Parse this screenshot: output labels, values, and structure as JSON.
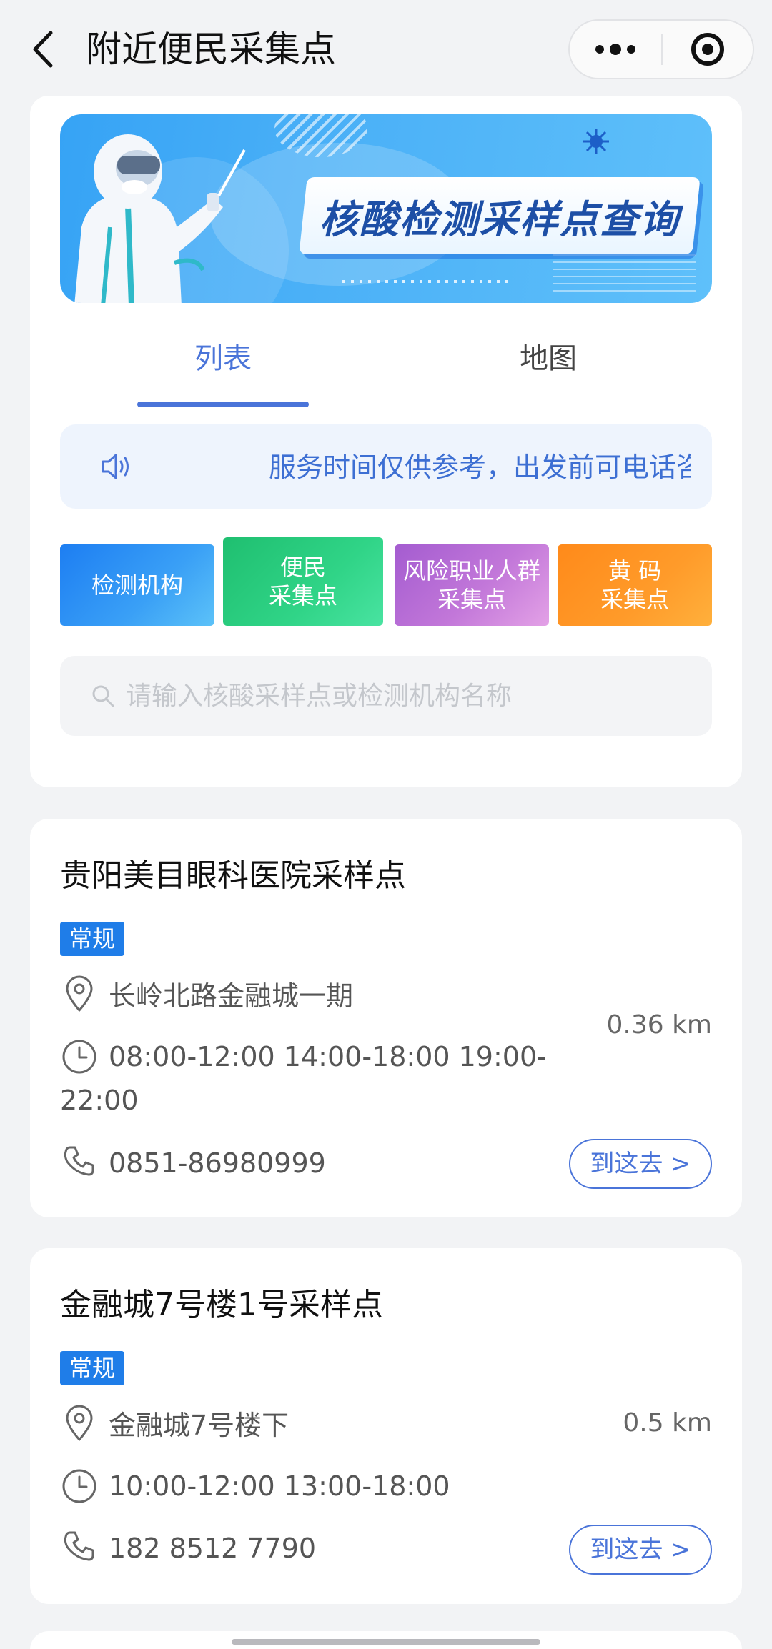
{
  "navbar": {
    "title": "附近便民采集点"
  },
  "banner": {
    "title": "核酸检测采样点查询"
  },
  "tabs": [
    {
      "label": "列表",
      "active": true
    },
    {
      "label": "地图",
      "active": false
    }
  ],
  "notice": {
    "text": "服务时间仅供参考，出发前可电话咨询"
  },
  "categories": [
    {
      "line1": "检测机构",
      "line2": ""
    },
    {
      "line1": "便民",
      "line2": "采集点"
    },
    {
      "line1": "风险职业人群",
      "line2": "采集点"
    },
    {
      "line1": "黄 码",
      "line2": "采集点"
    }
  ],
  "search": {
    "placeholder": "请输入核酸采样点或检测机构名称",
    "value": ""
  },
  "results": [
    {
      "name": "贵阳美目眼科医院采样点",
      "tag": "常规",
      "address": "长岭北路金融城一期",
      "hours": "08:00-12:00 14:00-18:00 19:00-22:00",
      "phone": "0851-86980999",
      "distance": "0.36 km",
      "action": "到这去 >"
    },
    {
      "name": "金融城7号楼1号采样点",
      "tag": "常规",
      "address": "金融城7号楼下",
      "hours": "10:00-12:00 13:00-18:00",
      "phone": "182 8512 7790",
      "distance": "0.5 km",
      "action": "到这去 >"
    }
  ],
  "colors": {
    "accent": "#4a74d9",
    "tag_blue": "#1f7de8",
    "page_bg": "#f2f3f5"
  }
}
